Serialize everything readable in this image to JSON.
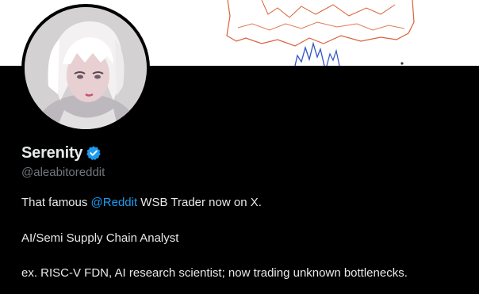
{
  "profile": {
    "display_name": "Serenity",
    "verified_icon": "verified-badge-icon",
    "handle": "@aleabitoreddit",
    "bio": {
      "line1_before": "That famous ",
      "line1_mention": "@Reddit",
      "line1_after": " WSB Trader now on X.",
      "line2": "AI/Semi Supply Chain Analyst",
      "line3": "ex. RISC-V FDN, AI research scientist; now trading unknown bottlenecks."
    }
  },
  "colors": {
    "background": "#000000",
    "primary_text": "#e7e9ea",
    "secondary_text": "#71767b",
    "accent": "#1d9bf0",
    "banner_background": "#ffffff"
  }
}
